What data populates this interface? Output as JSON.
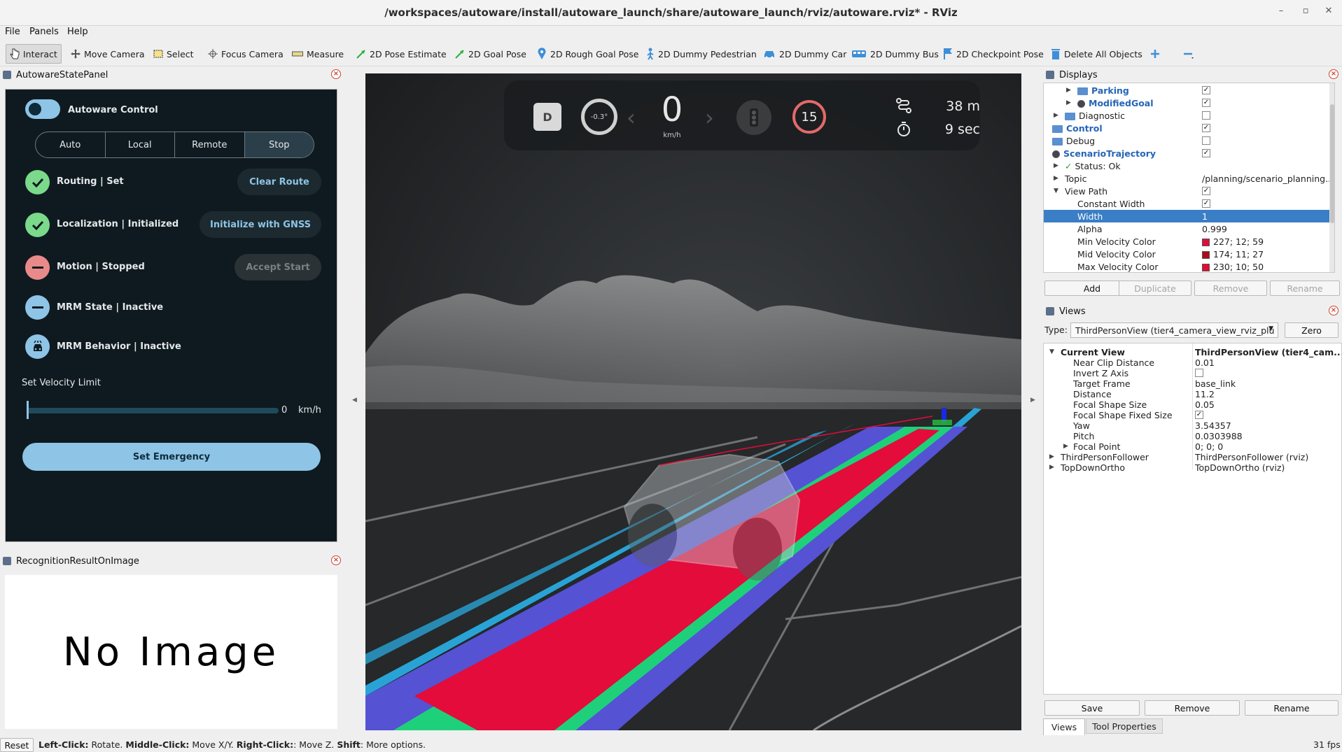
{
  "window": {
    "title": "/workspaces/autoware/install/autoware_launch/share/autoware_launch/rviz/autoware.rviz* - RViz",
    "minimize": "–",
    "restore": "▫",
    "close": "✕"
  },
  "menu": [
    "File",
    "Panels",
    "Help"
  ],
  "toolbar": {
    "tools": [
      {
        "label": "Interact",
        "icon": "cursor-hand-icon"
      },
      {
        "label": "Move Camera",
        "icon": "move-camera-icon"
      },
      {
        "label": "Select",
        "icon": "select-box-icon"
      },
      {
        "label": "Focus Camera",
        "icon": "focus-crosshair-icon"
      },
      {
        "label": "Measure",
        "icon": "ruler-icon"
      },
      {
        "label": "2D Pose Estimate",
        "icon": "green-arrow-icon"
      },
      {
        "label": "2D Goal Pose",
        "icon": "green-arrow-icon"
      },
      {
        "label": "2D Rough Goal Pose",
        "icon": "map-pin-icon"
      },
      {
        "label": "2D Dummy Pedestrian",
        "icon": "pedestrian-icon"
      },
      {
        "label": "2D Dummy Car",
        "icon": "car-icon"
      },
      {
        "label": "2D Dummy Bus",
        "icon": "bus-icon"
      },
      {
        "label": "2D Checkpoint Pose",
        "icon": "flag-icon"
      },
      {
        "label": "Delete All Objects",
        "icon": "trash-icon"
      }
    ],
    "add_icon": "plus-icon",
    "remove_icon": "minus-icon"
  },
  "autoware_panel": {
    "title": "AutowareStatePanel",
    "control_label": "Autoware Control",
    "modes": [
      "Auto",
      "Local",
      "Remote",
      "Stop"
    ],
    "selected_mode": "Stop",
    "routing": {
      "label": "Routing | Set",
      "button": "Clear Route"
    },
    "localization": {
      "label": "Localization | Initialized",
      "button": "Initialize with GNSS"
    },
    "motion": {
      "label": "Motion | Stopped",
      "button": "Accept Start"
    },
    "mrm_state": {
      "label": "MRM State | Inactive"
    },
    "mrm_behavior": {
      "label": "MRM Behavior | Inactive"
    },
    "velocity": {
      "label": "Set Velocity Limit",
      "value": "0",
      "unit": "km/h"
    },
    "emergency_button": "Set Emergency",
    "colors": {
      "ok": "#7ad98a",
      "error": "#e98a8a",
      "info": "#8ec4e6",
      "background": "#0f1a20"
    }
  },
  "recognition_panel": {
    "title": "RecognitionResultOnImage",
    "placeholder": "No Image"
  },
  "hud": {
    "gear": "D",
    "steering": "-0.3°",
    "speed": "0",
    "speed_unit": "km/h",
    "speed_limit": "15",
    "distance": "38 m",
    "time": "9 sec"
  },
  "displays": {
    "title": "Displays",
    "rows": [
      {
        "label": "Parking",
        "checked": true
      },
      {
        "label": "ModifiedGoal",
        "checked": true
      },
      {
        "label": "Diagnostic",
        "checked": false
      },
      {
        "label": "Control",
        "checked": true
      },
      {
        "label": "Debug",
        "checked": false
      },
      {
        "label": "ScenarioTrajectory",
        "checked": true
      },
      {
        "label": "Status: Ok"
      },
      {
        "label": "Topic",
        "value": "/planning/scenario_planning..."
      },
      {
        "label": "View Path",
        "checked": true
      },
      {
        "label": "Constant Width",
        "checked": true
      },
      {
        "label": "Width",
        "value": "1"
      },
      {
        "label": "Alpha",
        "value": "0.999"
      },
      {
        "label": "Min Velocity Color",
        "value": "227; 12; 59",
        "color": "#e30c3b"
      },
      {
        "label": "Mid Velocity Color",
        "value": "174; 11; 27",
        "color": "#ae0b1b"
      },
      {
        "label": "Max Velocity Color",
        "value": "230; 10; 50",
        "color": "#e60a32"
      }
    ],
    "buttons": [
      "Add",
      "Duplicate",
      "Remove",
      "Rename"
    ]
  },
  "views": {
    "title": "Views",
    "type_label": "Type:",
    "type_value": "ThirdPersonView (tier4_camera_view_rviz_plu",
    "zero_button": "Zero",
    "rows": [
      {
        "label": "Current View",
        "value": "ThirdPersonView (tier4_cam..."
      },
      {
        "label": "Near Clip Distance",
        "value": "0.01"
      },
      {
        "label": "Invert Z Axis",
        "value": ""
      },
      {
        "label": "Target Frame",
        "value": "base_link"
      },
      {
        "label": "Distance",
        "value": "11.2"
      },
      {
        "label": "Focal Shape Size",
        "value": "0.05"
      },
      {
        "label": "Focal Shape Fixed Size",
        "value": ""
      },
      {
        "label": "Yaw",
        "value": "3.54357"
      },
      {
        "label": "Pitch",
        "value": "0.0303988"
      },
      {
        "label": "Focal Point",
        "value": "0; 0; 0"
      },
      {
        "label": "ThirdPersonFollower",
        "value": "ThirdPersonFollower (rviz)"
      },
      {
        "label": "TopDownOrtho",
        "value": "TopDownOrtho (rviz)"
      }
    ],
    "buttons": [
      "Save",
      "Remove",
      "Rename"
    ],
    "tabs": [
      "Views",
      "Tool Properties"
    ]
  },
  "statusbar": {
    "reset": "Reset",
    "hint_parts": [
      {
        "b": "Left-Click:",
        "t": " Rotate. "
      },
      {
        "b": "Middle-Click:",
        "t": " Move X/Y. "
      },
      {
        "b": "Right-Click:",
        "t": ": Move Z. "
      },
      {
        "b": "Shift",
        "t": ": More options."
      }
    ],
    "fps": "31 fps"
  }
}
